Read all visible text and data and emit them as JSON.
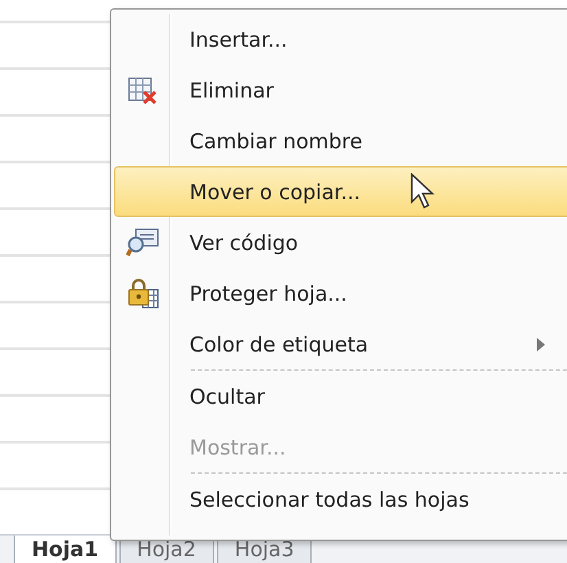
{
  "context_menu": {
    "items": [
      {
        "label": "Insertar...",
        "kind": "plain",
        "selected": false,
        "disabled": false,
        "submenu": false
      },
      {
        "label": "Eliminar",
        "kind": "delete",
        "selected": false,
        "disabled": false,
        "submenu": false
      },
      {
        "label": "Cambiar nombre",
        "kind": "plain",
        "selected": false,
        "disabled": false,
        "submenu": false
      },
      {
        "label": "Mover o copiar...",
        "kind": "plain",
        "selected": true,
        "disabled": false,
        "submenu": false
      },
      {
        "label": "Ver código",
        "kind": "code",
        "selected": false,
        "disabled": false,
        "submenu": false
      },
      {
        "label": "Proteger hoja...",
        "kind": "protect",
        "selected": false,
        "disabled": false,
        "submenu": false
      },
      {
        "label": "Color de etiqueta",
        "kind": "plain",
        "selected": false,
        "disabled": false,
        "submenu": true
      },
      {
        "kind": "separator"
      },
      {
        "label": "Ocultar",
        "kind": "plain",
        "selected": false,
        "disabled": false,
        "submenu": false
      },
      {
        "label": "Mostrar...",
        "kind": "plain",
        "selected": false,
        "disabled": true,
        "submenu": false
      },
      {
        "kind": "separator"
      },
      {
        "label": "Seleccionar todas las hojas",
        "kind": "plain",
        "selected": false,
        "disabled": false,
        "submenu": false
      }
    ]
  },
  "sheet_tabs": [
    {
      "label": "Hoja1",
      "selected": true
    },
    {
      "label": "Hoja2",
      "selected": false
    },
    {
      "label": "Hoja3",
      "selected": false
    }
  ]
}
